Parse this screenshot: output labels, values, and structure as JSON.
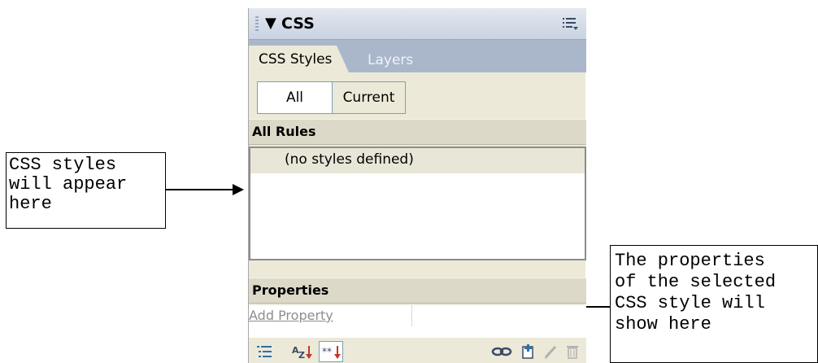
{
  "callouts": {
    "left_text": "CSS styles\nwill appear\nhere",
    "right_text": "The properties\nof the selected\nCSS style will\nshow here"
  },
  "panel": {
    "title": "CSS",
    "tabs": [
      {
        "label": "CSS Styles",
        "active": true
      },
      {
        "label": "Layers",
        "active": false
      }
    ],
    "mode_buttons": [
      {
        "label": "All",
        "selected": true
      },
      {
        "label": "Current",
        "selected": false
      }
    ],
    "rules_header": "All Rules",
    "rules_empty_text": "(no styles defined)",
    "properties_header": "Properties",
    "add_property_link": "Add Property",
    "toolbar_icons": [
      "category-view-icon",
      "alphabetical-view-icon",
      "set-properties-view-icon",
      "attach-stylesheet-icon",
      "new-css-rule-icon",
      "edit-style-icon",
      "delete-css-rule-icon"
    ]
  },
  "colors": {
    "panel_bg": "#ece9d8",
    "titlebar": "#c9d3e2",
    "tabbar": "#aab7cb"
  }
}
